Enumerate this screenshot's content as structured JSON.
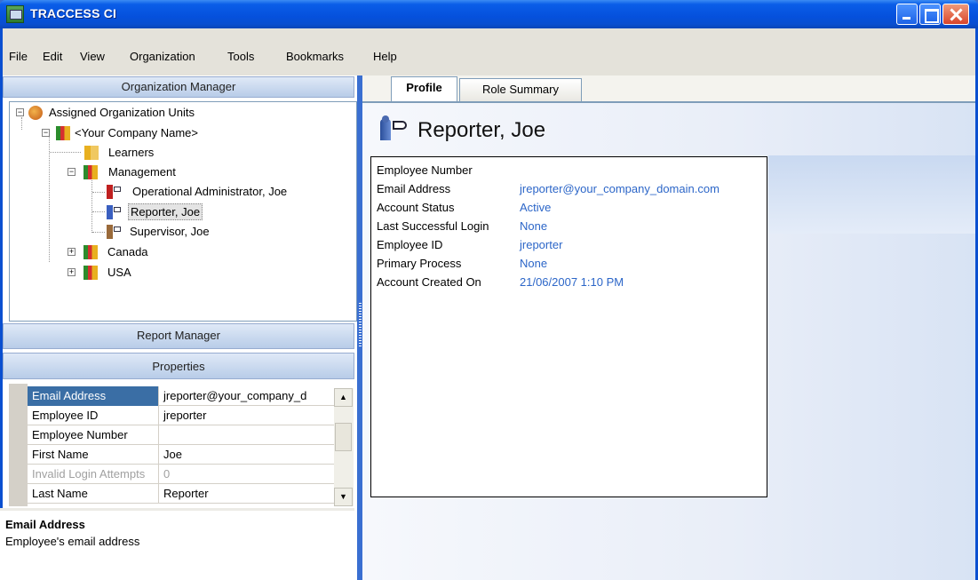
{
  "window": {
    "title": "TRACCESS CI"
  },
  "menu": [
    "File",
    "Edit",
    "View",
    "Organization",
    "Tools",
    "Bookmarks",
    "Help"
  ],
  "left": {
    "org_manager_header": "Organization Manager",
    "report_manager_header": "Report Manager",
    "properties_header": "Properties",
    "tree": [
      {
        "label": "Assigned Organization Units",
        "icon": "org-units-icon",
        "expander": "−"
      },
      {
        "label": "<Your Company Name>",
        "icon": "company-icon",
        "expander": "−"
      },
      {
        "label": "Learners",
        "icon": "group-icon",
        "expander": ""
      },
      {
        "label": "Management",
        "icon": "group-icon",
        "expander": "−"
      },
      {
        "label": "Operational Administrator, Joe",
        "icon": "user-icon",
        "expander": ""
      },
      {
        "label": "Reporter, Joe",
        "icon": "user-icon",
        "expander": ""
      },
      {
        "label": "Supervisor, Joe",
        "icon": "user-icon",
        "expander": ""
      },
      {
        "label": "Canada",
        "icon": "group-icon",
        "expander": "+"
      },
      {
        "label": "USA",
        "icon": "group-icon",
        "expander": "+"
      }
    ],
    "properties": [
      {
        "key": "Email Address",
        "value": "jreporter@your_company_d"
      },
      {
        "key": "Employee ID",
        "value": "jreporter"
      },
      {
        "key": "Employee Number",
        "value": ""
      },
      {
        "key": "First Name",
        "value": "Joe"
      },
      {
        "key": "Invalid Login Attempts",
        "value": "0"
      },
      {
        "key": "Last Name",
        "value": "Reporter"
      }
    ],
    "help": {
      "title": "Email Address",
      "description": "Employee's email address"
    }
  },
  "right": {
    "tabs": [
      "Profile",
      "Role Summary"
    ],
    "person_name": "Reporter, Joe",
    "fields": [
      {
        "key": "Employee Number",
        "value": ""
      },
      {
        "key": "Email Address",
        "value": "jreporter@your_company_domain.com"
      },
      {
        "key": "Account Status",
        "value": "Active"
      },
      {
        "key": "Last Successful Login",
        "value": "None"
      },
      {
        "key": "Employee ID",
        "value": "jreporter"
      },
      {
        "key": "Primary Process",
        "value": "None"
      },
      {
        "key": "Account Created On",
        "value": "21/06/2007 1:10 PM"
      }
    ]
  }
}
